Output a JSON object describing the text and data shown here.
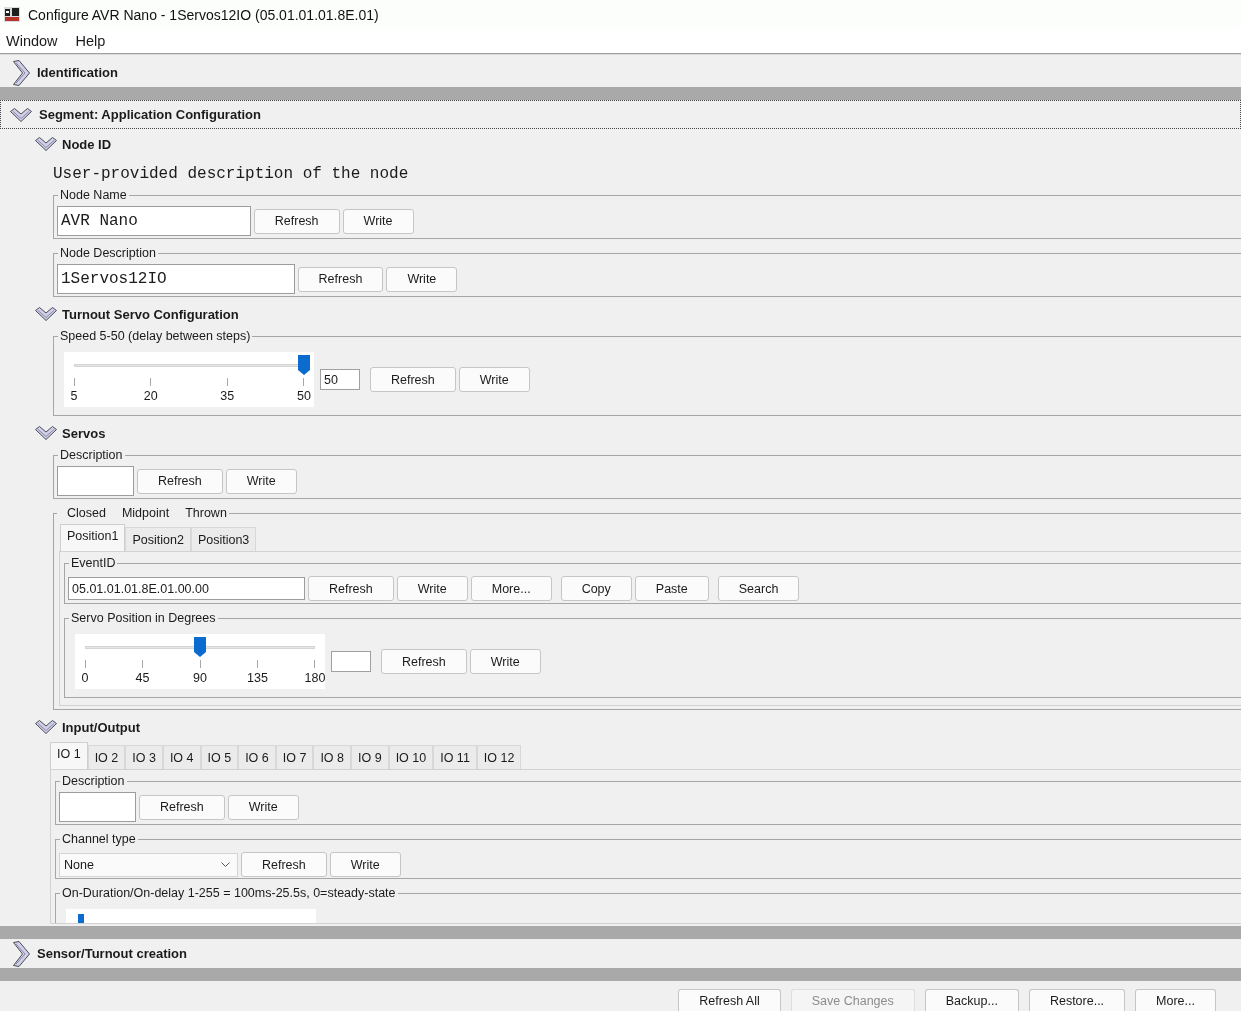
{
  "window": {
    "title": "Configure AVR Nano - 1Servos12IO (05.01.01.01.8E.01)"
  },
  "menu": [
    "Window",
    "Help"
  ],
  "sections": [
    {
      "title": "Identification",
      "expanded": false,
      "focused": false
    },
    {
      "title": "Segment: Application Configuration",
      "expanded": true,
      "focused": true,
      "groups": [
        {
          "title": "Node ID",
          "expanded": true,
          "description": "User-provided description of the node",
          "fields": [
            {
              "kind": "string",
              "label": "Node Name",
              "value": "AVR Nano",
              "buttons": [
                "Refresh",
                "Write"
              ]
            },
            {
              "kind": "string",
              "label": "Node Description",
              "value": "1Servos12IO",
              "buttons": [
                "Refresh",
                "Write"
              ]
            }
          ]
        },
        {
          "title": "Turnout Servo Configuration",
          "expanded": true,
          "fields": [
            {
              "kind": "slider",
              "label": "Speed 5-50 (delay between steps)",
              "ticks": [
                "5",
                "20",
                "35",
                "50"
              ],
              "level": 1,
              "value": "50",
              "buttons": [
                "Refresh",
                "Write"
              ]
            }
          ]
        },
        {
          "title": "Servos",
          "expanded": true,
          "fields": [
            {
              "kind": "string",
              "label": "Description",
              "buttons": [
                "Refresh",
                "Write"
              ]
            },
            {
              "kind": "tabset",
              "legend": [
                "Closed",
                "Midpoint",
                "Thrown"
              ],
              "tabs": [
                {
                  "label": "Position1",
                  "selected": true
                },
                {
                  "label": "Position2",
                  "selected": false
                },
                {
                  "label": "Position3",
                  "selected": false
                }
              ],
              "fields": [
                {
                  "kind": "event",
                  "label": "EventID",
                  "value": "05.01.01.01.8E.01.00.00",
                  "buttons": [
                    "Refresh",
                    "Write",
                    "More...",
                    "Copy",
                    "Paste",
                    "Search"
                  ]
                },
                {
                  "kind": "slider",
                  "label": "Servo Position in Degrees",
                  "ticks": [
                    "0",
                    "45",
                    "90",
                    "135",
                    "180"
                  ],
                  "level": 0.5,
                  "buttons": [
                    "Refresh",
                    "Write"
                  ]
                }
              ]
            }
          ]
        },
        {
          "title": "Input/Output",
          "expanded": true,
          "fields": [
            {
              "kind": "tabset",
              "tabs": [
                {
                  "label": "IO 1",
                  "selected": true
                },
                {
                  "label": "IO 2",
                  "selected": false
                },
                {
                  "label": "IO 3",
                  "selected": false
                },
                {
                  "label": "IO 4",
                  "selected": false
                },
                {
                  "label": "IO 5",
                  "selected": false
                },
                {
                  "label": "IO 6",
                  "selected": false
                },
                {
                  "label": "IO 7",
                  "selected": false
                },
                {
                  "label": "IO 8",
                  "selected": false
                },
                {
                  "label": "IO 9",
                  "selected": false
                },
                {
                  "label": "IO 10",
                  "selected": false
                },
                {
                  "label": "IO 11",
                  "selected": false
                },
                {
                  "label": "IO 12",
                  "selected": false
                }
              ],
              "fields": [
                {
                  "kind": "string",
                  "label": "Description",
                  "buttons": [
                    "Refresh",
                    "Write"
                  ]
                },
                {
                  "kind": "select",
                  "label": "Channel type",
                  "value": "None",
                  "buttons": [
                    "Refresh",
                    "Write"
                  ]
                },
                {
                  "kind": "slider",
                  "label": "On-Duration/On-delay 1-255 = 100ms-25.5s, 0=steady-state",
                  "level": 0
                }
              ]
            }
          ]
        }
      ]
    },
    {
      "title": "Sensor/Turnout creation",
      "expanded": false,
      "focused": false
    }
  ],
  "footer_buttons": [
    {
      "label": "Refresh All",
      "disabled": false
    },
    {
      "label": "Save Changes",
      "disabled": true
    },
    {
      "label": "Backup...",
      "disabled": false
    },
    {
      "label": "Restore...",
      "disabled": false
    },
    {
      "label": "More...",
      "disabled": false
    }
  ]
}
